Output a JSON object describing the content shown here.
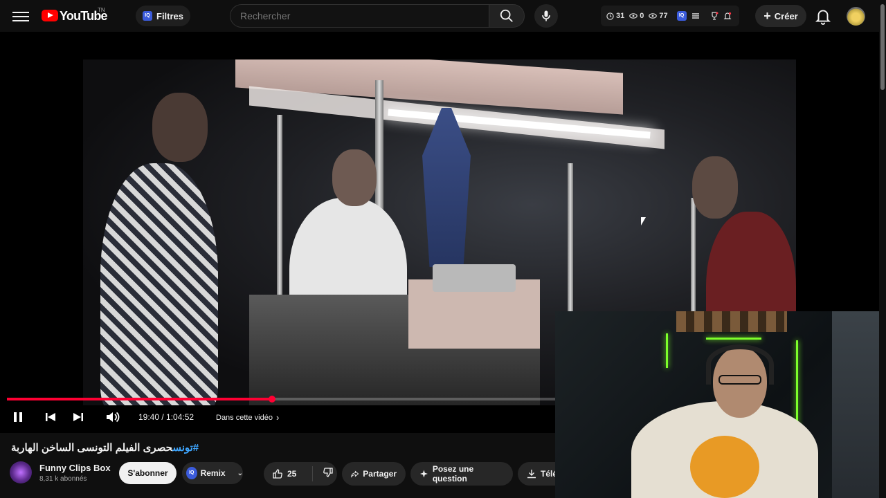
{
  "header": {
    "logo_text": "YouTube",
    "country_code": "TN",
    "filter_button_label": "Filtres",
    "filter_badge": "IQ",
    "search_placeholder": "Rechercher",
    "stats": {
      "watch_count": "31",
      "views_a": "0",
      "views_b": "77",
      "badge": "IQ"
    },
    "create_label": "Créer"
  },
  "player": {
    "progress_fraction": 0.3057,
    "current_time": "19:40",
    "duration": "1:04:52",
    "time_display": "19:40 / 1:04:52",
    "chapter_label": "Dans cette vidéo"
  },
  "video": {
    "hashtag": "#تونس",
    "title_rest": "حصرى الفيلم التونسى الساخن الهاربة"
  },
  "channel": {
    "name": "Funny Clips Box",
    "subscribers": "8,31 k abonnés",
    "subscribe_label": "S'abonner"
  },
  "actions": {
    "remix_badge": "IQ",
    "remix_label": "Remix",
    "like_count": "25",
    "share_label": "Partager",
    "ask_label": "Posez une question",
    "download_label": "Télé"
  },
  "colors": {
    "background": "#0f0f0f",
    "progress": "#ff0033",
    "brand": "#ff0000",
    "hashtag": "#3ea6ff"
  },
  "icons": {
    "menu": "hamburger-icon",
    "search": "search-icon",
    "mic": "mic-icon",
    "bell": "bell-icon",
    "like": "thumbs-up-icon",
    "dislike": "thumbs-down-icon",
    "share": "share-icon",
    "ask": "sparkle-icon",
    "download": "download-icon"
  }
}
